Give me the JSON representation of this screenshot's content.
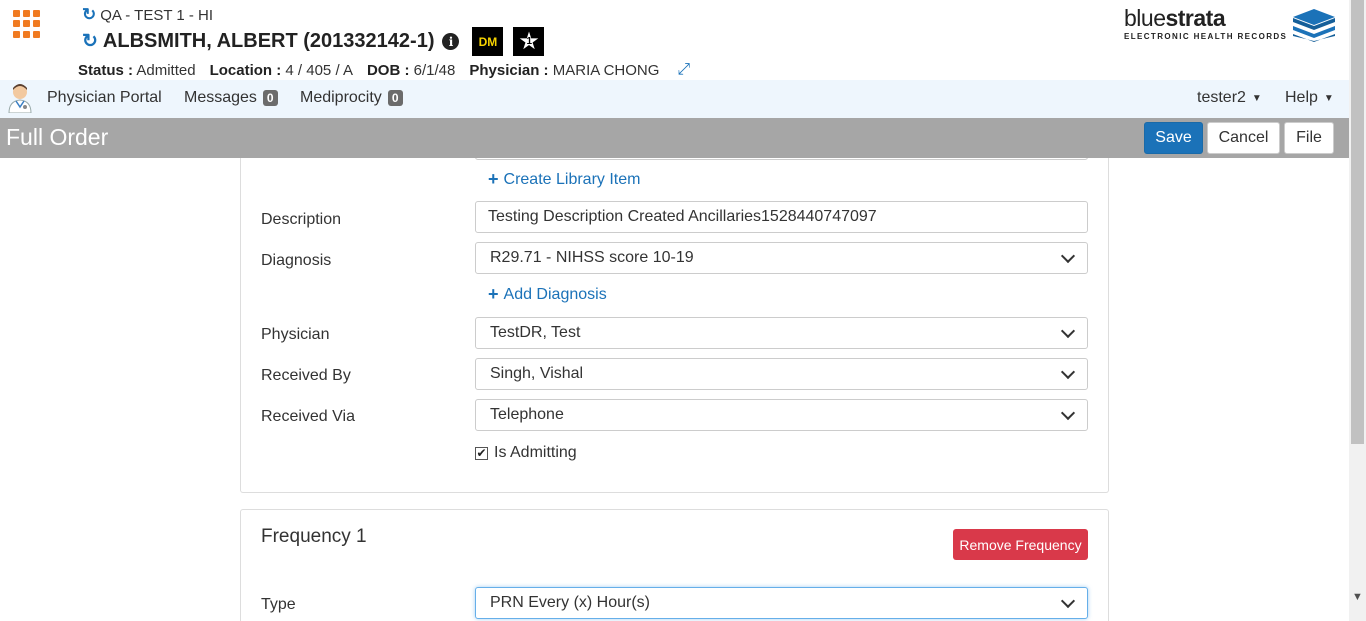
{
  "header": {
    "facility": "QA - TEST 1 - HI",
    "patient_name": "ALBSMITH, ALBERT (201332142-1)",
    "badge_dm": "DM",
    "status_label": "Status :",
    "status_value": "Admitted",
    "location_label": "Location :",
    "location_value": "4 / 405 / A",
    "dob_label": "DOB :",
    "dob_value": "6/1/48",
    "physician_label": "Physician :",
    "physician_value": "MARIA CHONG"
  },
  "logo": {
    "word_light": "blue",
    "word_bold": "strata",
    "tagline": "ELECTRONIC HEALTH RECORDS"
  },
  "nav": {
    "portal": "Physician Portal",
    "messages": "Messages",
    "messages_count": "0",
    "mediprocity": "Mediprocity",
    "mediprocity_count": "0",
    "user": "tester2",
    "help": "Help"
  },
  "titlebar": {
    "title": "Full Order",
    "save": "Save",
    "cancel": "Cancel",
    "file": "File"
  },
  "form": {
    "create_library_item": "Create Library Item",
    "description_label": "Description",
    "description_value": "Testing Description Created Ancillaries1528440747097",
    "diagnosis_label": "Diagnosis",
    "diagnosis_value": "R29.71 - NIHSS score 10-19",
    "add_diagnosis": "Add Diagnosis",
    "physician_label": "Physician",
    "physician_value": "TestDR, Test",
    "received_by_label": "Received By",
    "received_by_value": "Singh, Vishal",
    "received_via_label": "Received Via",
    "received_via_value": "Telephone",
    "is_admitting_label": "Is Admitting",
    "is_admitting_checked": true
  },
  "frequency": {
    "title": "Frequency 1",
    "remove_button": "Remove Frequency",
    "type_label": "Type",
    "type_value": "PRN Every (x) Hour(s)"
  },
  "colors": {
    "accent_blue": "#1b72b8",
    "app_grid_orange": "#f07b22",
    "danger_red": "#d9394a",
    "titlebar_gray": "#a6a6a6",
    "nav_bg": "#eef6fd"
  }
}
